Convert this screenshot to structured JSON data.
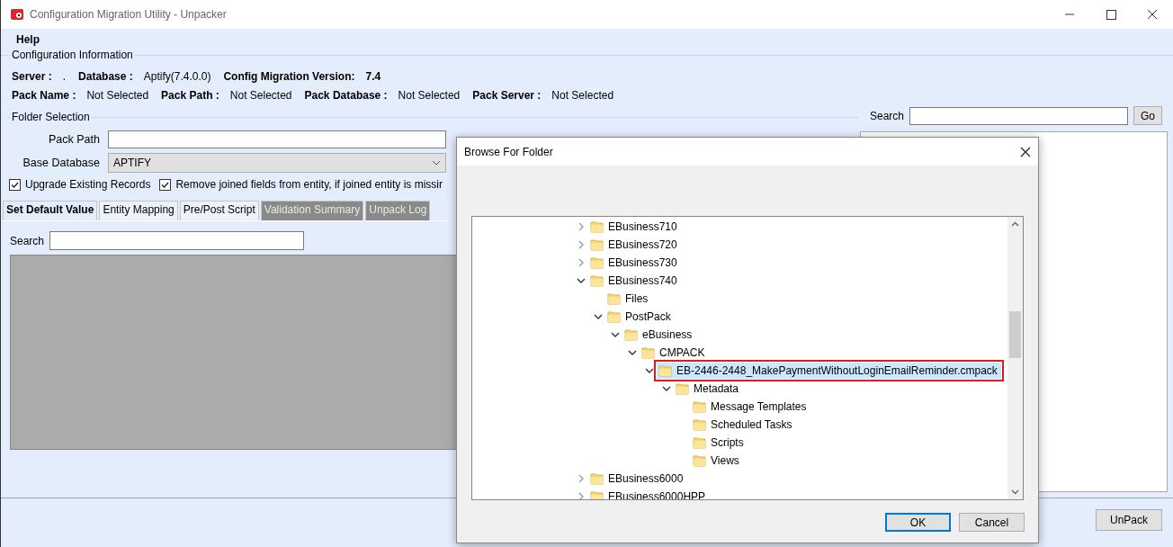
{
  "window": {
    "title": "Configuration Migration Utility - Unpacker"
  },
  "menu": [
    {
      "label": "Help"
    }
  ],
  "config_info": {
    "title": "Configuration Information",
    "rows": [
      [
        {
          "label": "Server :",
          "value": ".",
          "strong": false
        },
        {
          "label": "Database :",
          "value": "Aptify(7.4.0.0)",
          "strong": false
        },
        {
          "label": "Config Migration Version:",
          "value": "7.4",
          "strong": true
        }
      ],
      [
        {
          "label": "Pack Name :",
          "value": "Not Selected",
          "strong": false
        },
        {
          "label": "Pack Path :",
          "value": "Not Selected",
          "strong": false
        },
        {
          "label": "Pack Database :",
          "value": "Not Selected",
          "strong": false
        },
        {
          "label": "Pack Server :",
          "value": "Not Selected",
          "strong": false
        }
      ]
    ]
  },
  "folder_selection": {
    "title": "Folder Selection",
    "pack_path": {
      "label": "Pack Path"
    },
    "base_database": {
      "label": "Base Database",
      "value": "APTIFY"
    },
    "options": [
      {
        "label": "Upgrade Existing Records",
        "checked": true
      },
      {
        "label": "Remove joined fields from entity, if joined entity is missir",
        "checked": true
      }
    ]
  },
  "tabs": [
    {
      "label": "Set Default Value",
      "selected": true,
      "disabled": false
    },
    {
      "label": "Entity Mapping",
      "selected": false,
      "disabled": false
    },
    {
      "label": "Pre/Post Script",
      "selected": false,
      "disabled": false
    },
    {
      "label": "Validation Summary",
      "selected": false,
      "disabled": true
    },
    {
      "label": "Unpack Log",
      "selected": false,
      "disabled": true
    }
  ],
  "tab_search": {
    "label": "Search"
  },
  "right_search": {
    "label": "Search",
    "button": "Go"
  },
  "unpack_button": "UnPack",
  "dialog": {
    "title": "Browse For Folder",
    "tree": [
      {
        "label": "EBusiness710",
        "expanded": false,
        "selected": false
      },
      {
        "label": "EBusiness720",
        "expanded": false,
        "selected": false
      },
      {
        "label": "EBusiness730",
        "expanded": false,
        "selected": false
      },
      {
        "label": "EBusiness740",
        "expanded": true,
        "selected": false,
        "children": [
          {
            "label": "Files",
            "selected": false
          },
          {
            "label": "PostPack",
            "expanded": true,
            "selected": false,
            "children": [
              {
                "label": "eBusiness",
                "expanded": true,
                "selected": false,
                "children": [
                  {
                    "label": "CMPACK",
                    "expanded": true,
                    "selected": false,
                    "children": [
                      {
                        "label": "EB-2446-2448_MakePaymentWithoutLoginEmailReminder.cmpack",
                        "expanded": true,
                        "selected": true,
                        "children": [
                          {
                            "label": "Metadata",
                            "expanded": true,
                            "selected": false,
                            "children": [
                              {
                                "label": "Message Templates",
                                "selected": false
                              },
                              {
                                "label": "Scheduled Tasks",
                                "selected": false
                              },
                              {
                                "label": "Scripts",
                                "selected": false
                              },
                              {
                                "label": "Views",
                                "selected": false
                              }
                            ]
                          }
                        ]
                      }
                    ]
                  }
                ]
              }
            ]
          }
        ]
      },
      {
        "label": "EBusiness6000",
        "expanded": false,
        "selected": false
      },
      {
        "label": "EBusiness6000HPP",
        "expanded": false,
        "selected": false
      }
    ],
    "buttons": [
      "OK",
      "Cancel"
    ]
  }
}
